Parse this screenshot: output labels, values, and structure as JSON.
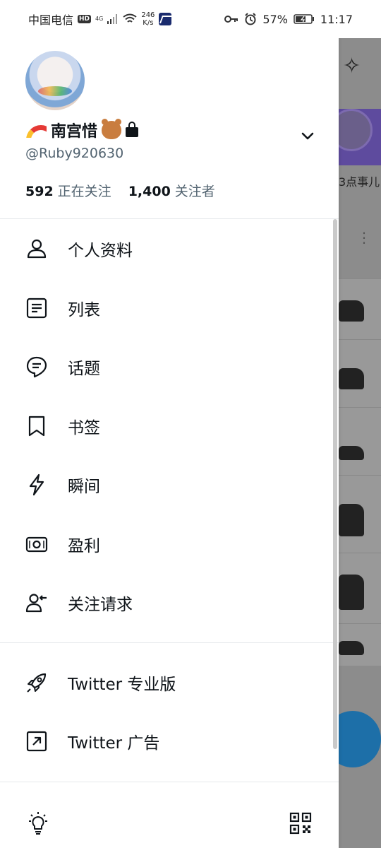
{
  "status_bar": {
    "carrier": "中国电信",
    "hd": "HD",
    "net_type": "4G",
    "speed_value": "246",
    "speed_unit": "K/s",
    "battery": "57%",
    "time": "11:17"
  },
  "background": {
    "text_fragment": "3点事儿"
  },
  "profile": {
    "display_name": "南宫惜",
    "handle": "@Ruby920630",
    "following_count": "592",
    "following_label": "正在关注",
    "followers_count": "1,400",
    "followers_label": "关注者"
  },
  "menu": [
    {
      "label": "个人资料",
      "icon": "person-icon"
    },
    {
      "label": "列表",
      "icon": "list-icon"
    },
    {
      "label": "话题",
      "icon": "topics-icon"
    },
    {
      "label": "书签",
      "icon": "bookmark-icon"
    },
    {
      "label": "瞬间",
      "icon": "lightning-icon"
    },
    {
      "label": "盈利",
      "icon": "money-icon"
    },
    {
      "label": "关注请求",
      "icon": "follow-request-icon"
    }
  ],
  "menu2": [
    {
      "label": "Twitter 专业版",
      "icon": "rocket-icon"
    },
    {
      "label": "Twitter 广告",
      "icon": "external-link-icon"
    }
  ],
  "bottom": {
    "left_icon": "lightbulb-icon",
    "right_icon": "qr-code-icon"
  }
}
